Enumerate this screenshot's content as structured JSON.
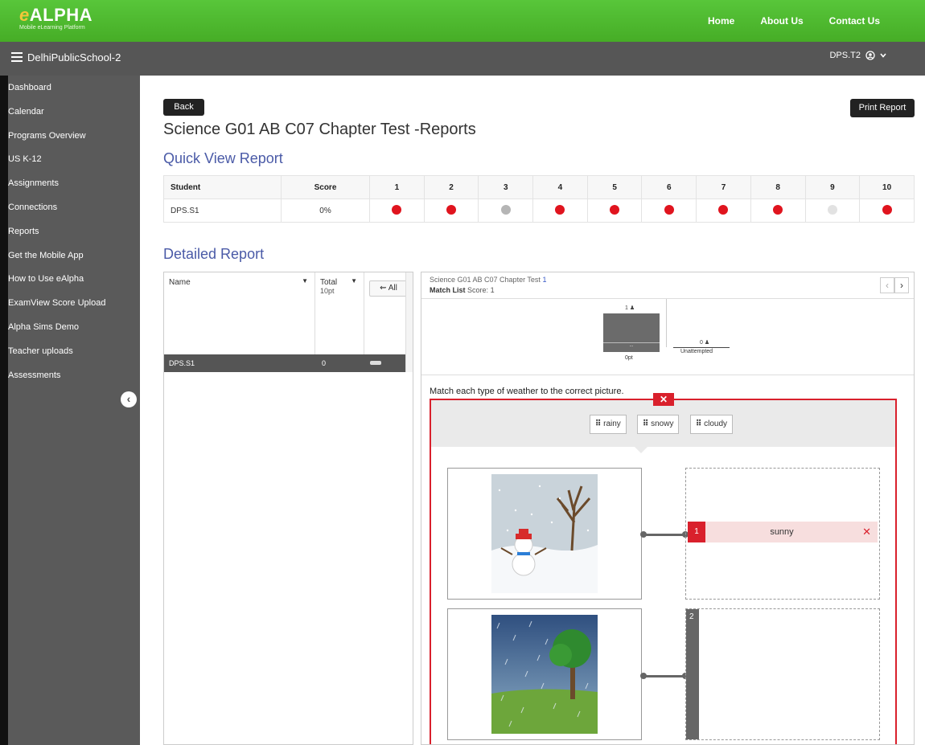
{
  "brand": {
    "name": "ALPHA",
    "name_prefix": "e",
    "tagline": "Mobile eLearning Platform"
  },
  "topnav": [
    "Home",
    "About Us",
    "Contact Us"
  ],
  "subbar": {
    "school": "DelhiPublicSchool-2",
    "user": "DPS.T2"
  },
  "sidebar": {
    "items": [
      "Dashboard",
      "Calendar",
      "Programs Overview",
      "US K-12",
      "Assignments",
      "Connections",
      "Reports",
      "Get the Mobile App",
      "How to Use eAlpha",
      "ExamView Score Upload",
      "Alpha Sims Demo",
      "Teacher uploads",
      "Assessments"
    ]
  },
  "main": {
    "back_label": "Back",
    "print_label": "Print Report",
    "title": "Science G01 AB C07 Chapter Test -Reports",
    "quick_title": "Quick View Report",
    "detailed_title": "Detailed Report"
  },
  "quick_table": {
    "headers": [
      "Student",
      "Score",
      "1",
      "2",
      "3",
      "4",
      "5",
      "6",
      "7",
      "8",
      "9",
      "10"
    ],
    "rows": [
      {
        "student": "DPS.S1",
        "score": "0%",
        "results": [
          "incorrect",
          "incorrect",
          "partial",
          "incorrect",
          "incorrect",
          "incorrect",
          "incorrect",
          "incorrect",
          "unattempted",
          "incorrect"
        ]
      }
    ],
    "colors": {
      "incorrect": "#e0141e",
      "partial": "#b5b5b5",
      "unattempted": "#e2e2e2"
    }
  },
  "detail_left": {
    "name_header": "Name",
    "total_header": "Total",
    "total_points": "10pt",
    "all_label": "All",
    "row": {
      "name": "DPS.S1",
      "total": "0"
    }
  },
  "detail_right": {
    "test_name": "Science G01 AB C07 Chapter Test",
    "question_no": "1",
    "type_label": "Match List",
    "score_label": "Score:",
    "score_value": "1",
    "chart": {
      "bar1_count": "1",
      "bar1_label": "0pt",
      "bar1_inner": "...",
      "bar2_count": "0",
      "bar2_label": "Unattempted"
    },
    "question": "Match each type of weather to the correct picture.",
    "choices": [
      "rainy",
      "snowy",
      "cloudy"
    ],
    "pairs": [
      {
        "num": "1",
        "answer": "sunny",
        "status": "incorrect"
      },
      {
        "num": "2",
        "answer": "",
        "status": "empty"
      }
    ]
  }
}
